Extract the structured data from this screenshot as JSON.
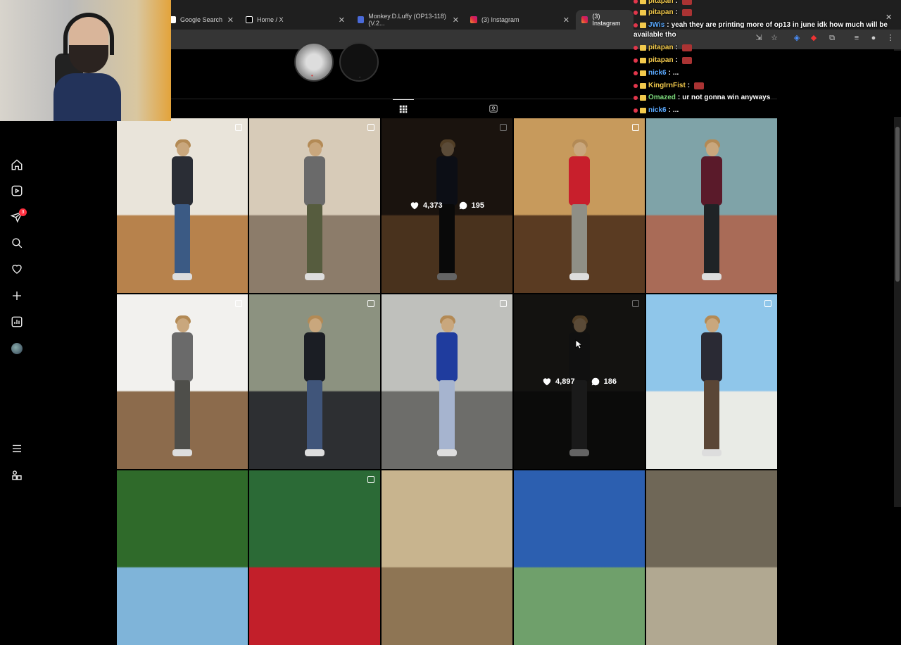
{
  "browser": {
    "tabs": [
      {
        "label": "Google Search",
        "icon": "google-icon"
      },
      {
        "label": "Home / X",
        "icon": "x-icon"
      },
      {
        "label": "Monkey.D.Luffy (OP13-118) (V.2...",
        "icon": "document-icon"
      },
      {
        "label": "(3) Instagram",
        "icon": "instagram-icon"
      },
      {
        "label": "(3) Instagram",
        "icon": "instagram-icon",
        "active": true
      }
    ]
  },
  "sidebar": {
    "items": [
      {
        "name": "home",
        "icon": "home-icon"
      },
      {
        "name": "reels",
        "icon": "reels-icon"
      },
      {
        "name": "messages",
        "icon": "paper-plane-icon",
        "badge": "3"
      },
      {
        "name": "search",
        "icon": "search-icon"
      },
      {
        "name": "notifications",
        "icon": "heart-icon"
      },
      {
        "name": "create",
        "icon": "plus-icon"
      },
      {
        "name": "dashboard",
        "icon": "chart-icon"
      },
      {
        "name": "profile",
        "icon": "avatar-icon"
      },
      {
        "name": "more",
        "icon": "menu-icon"
      },
      {
        "name": "also-from-meta",
        "icon": "apps-icon"
      }
    ]
  },
  "profile": {
    "tabs": [
      {
        "name": "posts",
        "icon": "grid-icon",
        "active": true
      },
      {
        "name": "tagged",
        "icon": "tagged-icon",
        "active": false
      }
    ]
  },
  "posts": [
    {
      "scene": "kitchen",
      "multi": true
    },
    {
      "scene": "game-room",
      "multi": true
    },
    {
      "scene": "staircase",
      "multi": true,
      "hover": true,
      "likes": "4,373",
      "comments": "195"
    },
    {
      "scene": "stone-doorway",
      "multi": true
    },
    {
      "scene": "balcony",
      "multi": false
    },
    {
      "scene": "white-door",
      "multi": true
    },
    {
      "scene": "suv-street",
      "multi": true
    },
    {
      "scene": "mercedes-park",
      "multi": true
    },
    {
      "scene": "dark-restaurant",
      "multi": true,
      "hover": true,
      "likes": "4,897",
      "comments": "186"
    },
    {
      "scene": "high-rise-window",
      "multi": true
    },
    {
      "scene": "trees",
      "multi": false
    },
    {
      "scene": "storefront",
      "multi": true
    },
    {
      "scene": "chandelier",
      "multi": false
    },
    {
      "scene": "city-building",
      "multi": false
    },
    {
      "scene": "sketch-wall",
      "multi": false
    }
  ],
  "chat": [
    {
      "user": "pitapan",
      "text": "",
      "color": "#f2c94c",
      "emote": true
    },
    {
      "user": "pitapan",
      "text": "",
      "color": "#f2c94c",
      "emote": true
    },
    {
      "user": "JWis",
      "text": "yeah they are printing more of op13 in june idk how much will be",
      "color": "#5aa9ff"
    },
    {
      "user": "",
      "text": "available tho",
      "color": "#ffffff"
    },
    {
      "user": "pitapan",
      "text": "",
      "color": "#f2c94c",
      "emote": true
    },
    {
      "user": "pitapan",
      "text": "",
      "color": "#f2c94c",
      "emote": true
    },
    {
      "user": "nick6",
      "text": "...",
      "color": "#5aa9ff"
    },
    {
      "user": "KingIrnFist",
      "text": "",
      "color": "#f2c94c",
      "emote": true
    },
    {
      "user": "Omazed",
      "text": "ur not gonna win anyways",
      "color": "#7ddc7d"
    },
    {
      "user": "nick6",
      "text": "...",
      "color": "#5aa9ff"
    }
  ]
}
